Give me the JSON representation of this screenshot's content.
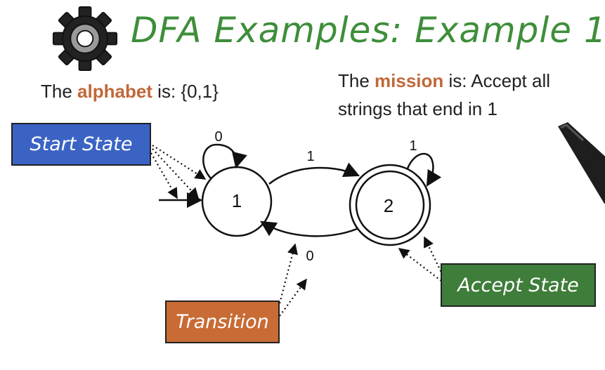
{
  "title": "DFA Examples: Example 1",
  "alphabet": {
    "prefix": "The ",
    "keyword": "alphabet",
    "suffix": " is:  {0,1}"
  },
  "mission": {
    "prefix": "The ",
    "keyword": "mission",
    "suffix": " is: Accept all",
    "line2": "strings that end in 1"
  },
  "labels": {
    "start_state": "Start State",
    "accept_state": "Accept State",
    "transition": "Transition"
  },
  "states": {
    "s1": "1",
    "s2": "2"
  },
  "transitions": {
    "loop1": "0",
    "t12": "1",
    "loop2": "1",
    "t21": "0"
  },
  "colors": {
    "title_green": "#3e8e3a",
    "highlight": "#c0683a",
    "start_box": "#3a63c4",
    "accept_box": "#3f7d3a",
    "transition_box": "#c86b34"
  },
  "icons": {
    "gear": "gear-icon",
    "pen": "pen-tip"
  }
}
